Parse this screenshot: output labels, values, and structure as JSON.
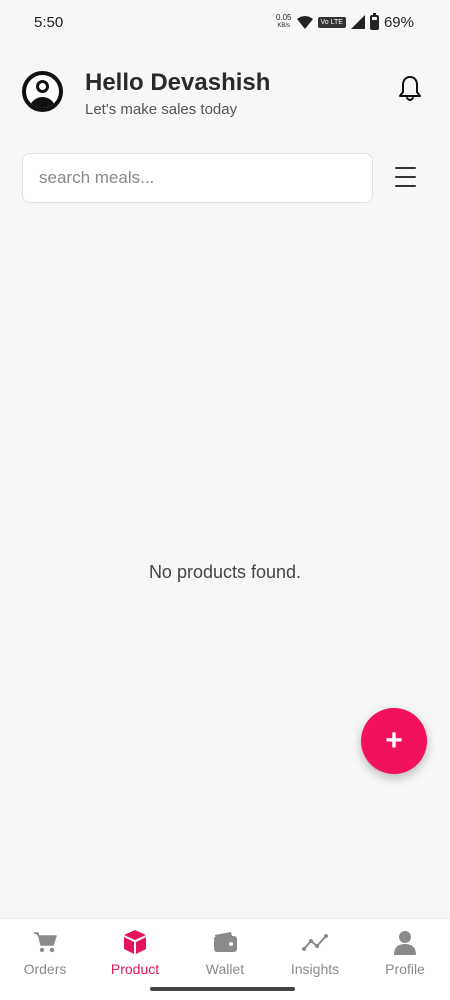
{
  "status_bar": {
    "time": "5:50",
    "net_speed_value": "0.05",
    "net_speed_unit": "KB/s",
    "volte": "Vo LTE",
    "battery": "69%",
    "battery_level": 0.69
  },
  "header": {
    "greeting": "Hello Devashish",
    "subtitle": "Let's make sales today",
    "avatar_icon": "user-circle-icon",
    "notification_icon": "bell-icon"
  },
  "search": {
    "placeholder": "search meals...",
    "value": "",
    "menu_icon": "hamburger-menu-icon"
  },
  "main": {
    "empty_message": "No products found."
  },
  "fab": {
    "label": "+",
    "color": "#f2115d"
  },
  "bottom_nav": {
    "active_color": "#e4145e",
    "inactive_color": "#8a8a8a",
    "items": [
      {
        "label": "Orders",
        "icon": "cart-icon",
        "active": false
      },
      {
        "label": "Product",
        "icon": "box-icon",
        "active": true
      },
      {
        "label": "Wallet",
        "icon": "wallet-icon",
        "active": false
      },
      {
        "label": "Insights",
        "icon": "chart-line-icon",
        "active": false
      },
      {
        "label": "Profile",
        "icon": "person-icon",
        "active": false
      }
    ]
  }
}
